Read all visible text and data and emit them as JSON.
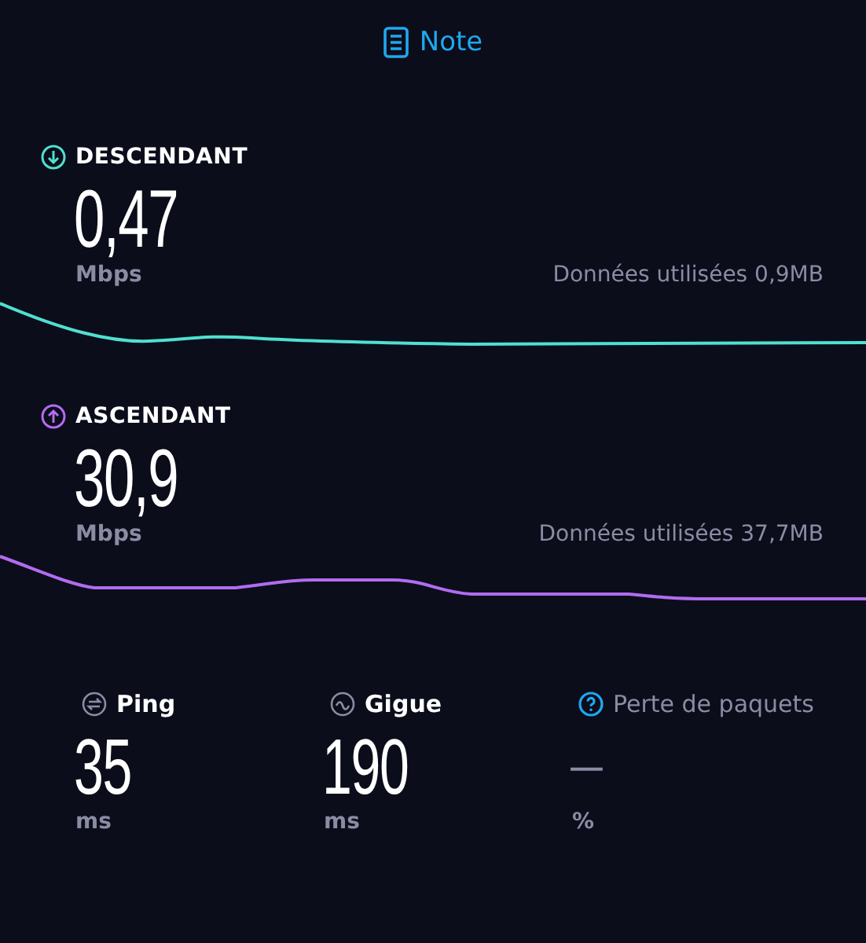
{
  "header": {
    "label": "Note"
  },
  "speeds": [
    {
      "kind": "download",
      "label": "DESCENDANT",
      "color": "#4fe0d0",
      "value": "0,47",
      "unit": "Mbps",
      "data_used": "Données utilisées 0,9MB"
    },
    {
      "kind": "upload",
      "label": "ASCENDANT",
      "color": "#b26cf0",
      "value": "30,9",
      "unit": "Mbps",
      "data_used": "Données utilisées 37,7MB"
    }
  ],
  "metrics": [
    {
      "kind": "ping",
      "label": "Ping",
      "value": "35",
      "unit": "ms",
      "disabled": false
    },
    {
      "kind": "jitter",
      "label": "Gigue",
      "value": "190",
      "unit": "ms",
      "disabled": false
    },
    {
      "kind": "packet_loss",
      "label": "Perte de paquets",
      "value": "—",
      "unit": "%",
      "disabled": true
    }
  ]
}
